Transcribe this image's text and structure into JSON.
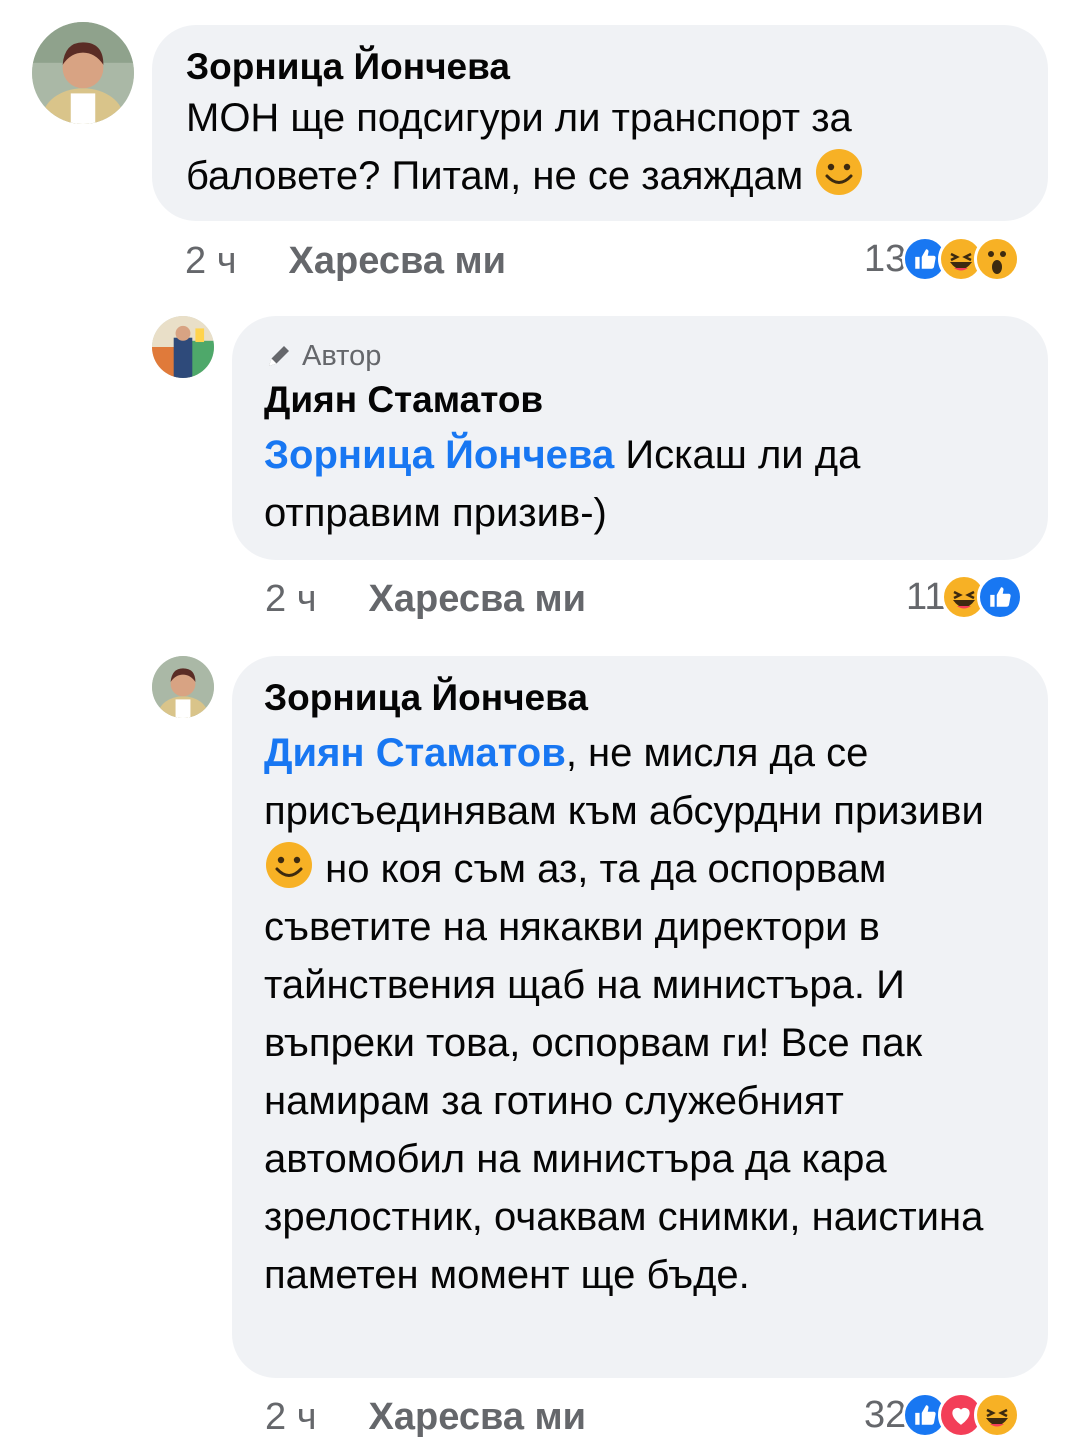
{
  "comments": [
    {
      "author": "Зорница Йончева",
      "text": "МОН ще подсигури ли транспорт за баловете? Питам, не се заяждам",
      "time": "2 ч",
      "like_label": "Харесва ми",
      "reaction_count": "13",
      "reactions": [
        "like-icon",
        "haha-icon",
        "wow-icon"
      ]
    },
    {
      "author_badge": "Автор",
      "author": "Диян Стаматов",
      "mention": "Зорница Йончева",
      "text": "Искаш ли да отправим призив-)",
      "time": "2 ч",
      "like_label": "Харесва ми",
      "reaction_count": "11",
      "reactions": [
        "haha-icon",
        "like-icon"
      ]
    },
    {
      "author": "Зорница Йончева",
      "mention": "Диян Стаматов",
      "text_part1": ", не мисля да се присъединявам към абсурдни призиви",
      "text_part2": "но коя съм аз, та да оспорвам съветите на някакви директори в тайнствения щаб на министъра. И въпреки това, оспорвам ги! Все пак намирам за готино служебният автомобил на министъра да кара зрелостник, очаквам снимки, наистина паметен момент ще бъде.",
      "time": "2 ч",
      "like_label": "Харесва ми",
      "reaction_count": "32",
      "reactions": [
        "like-icon",
        "love-icon",
        "haha-icon"
      ]
    }
  ],
  "colors": {
    "bubble": "#f0f2f5",
    "mention": "#1877f2",
    "meta": "#65676b",
    "like": "#1877f2",
    "love": "#f33e58",
    "emoji": "#f7b125"
  }
}
